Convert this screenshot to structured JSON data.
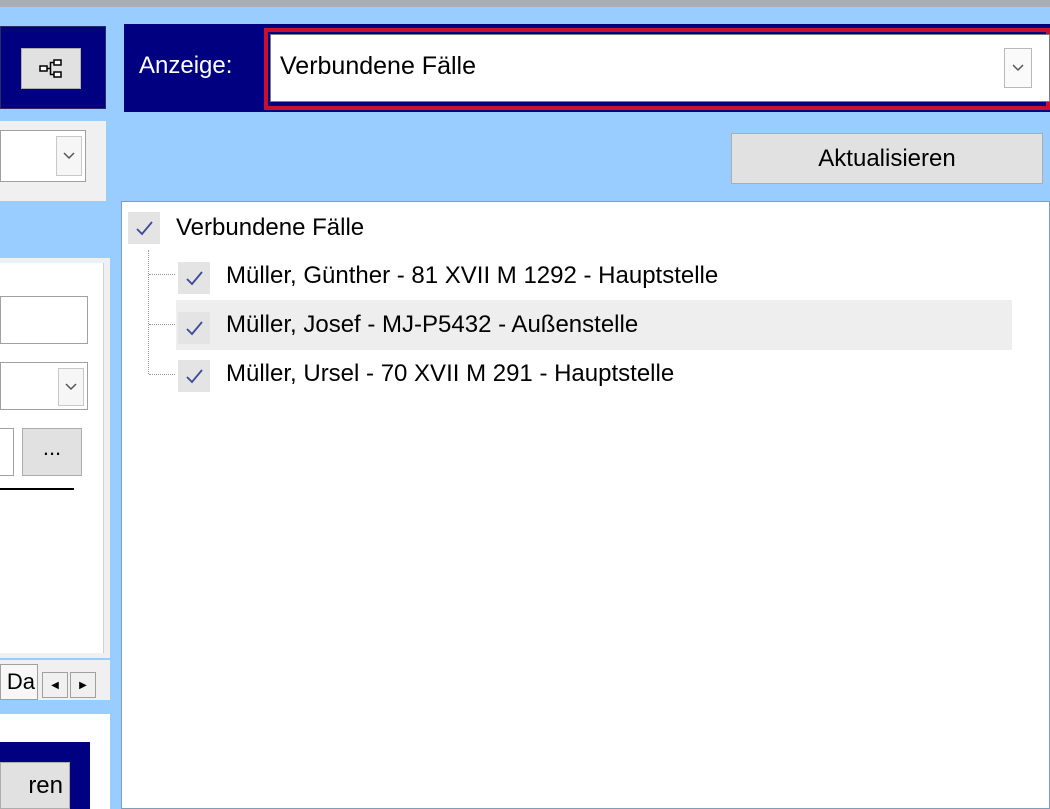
{
  "left": {
    "tree_button_icon": "hierarchy-tree-icon",
    "ellipsis_label": "...",
    "tab_partial_label": "Da",
    "tab_prev_icon": "arrow-left-icon",
    "tab_next_icon": "arrow-right-icon",
    "bottom_button_label": "ren"
  },
  "view": {
    "label": "Anzeige:",
    "selected": "Verbundene Fälle",
    "highlight_color": "#c8102e"
  },
  "toolbar": {
    "refresh_label": "Aktualisieren"
  },
  "tree": {
    "root": {
      "label": "Verbundene Fälle",
      "checked": true
    },
    "children": [
      {
        "label": "Müller, Günther - 81 XVII M 1292 - Hauptstelle",
        "checked": true
      },
      {
        "label": "Müller, Josef - MJ-P5432 - Außenstelle",
        "checked": true,
        "hovered": true
      },
      {
        "label": "Müller, Ursel - 70 XVII M 291 - Hauptstelle",
        "checked": true
      }
    ]
  },
  "colors": {
    "background": "#99ccff",
    "frame_navy": "#000080",
    "check_mark": "#3b4a9a"
  }
}
